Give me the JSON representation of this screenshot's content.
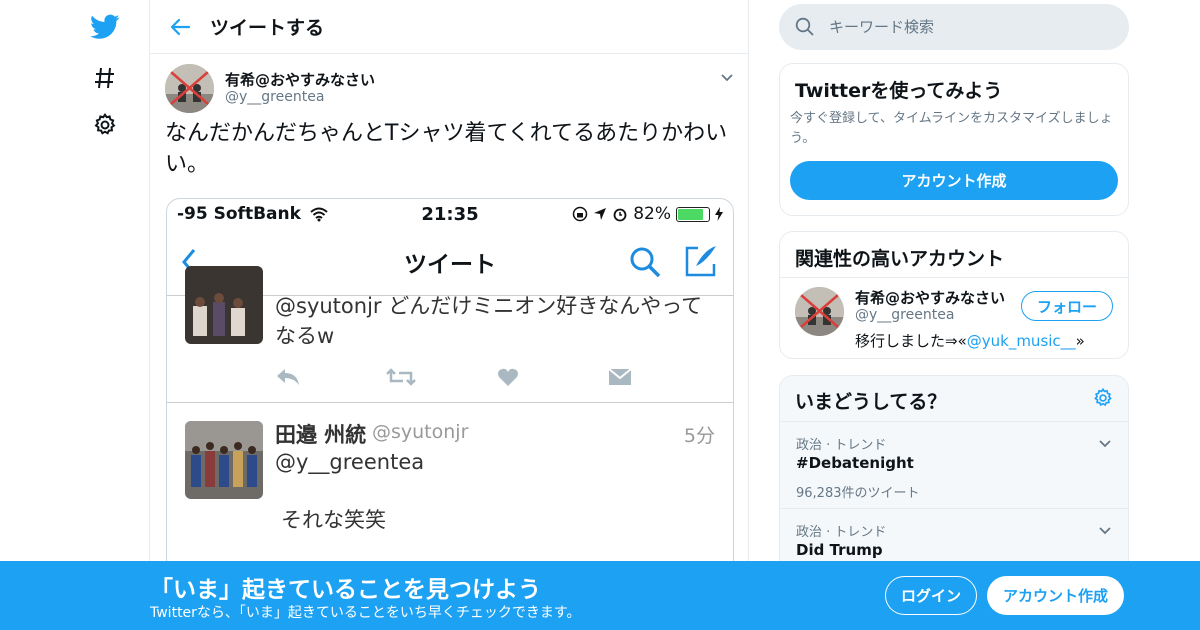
{
  "nav": {
    "icons": [
      "twitter-bird-icon",
      "hashtag-icon",
      "gear-icon"
    ]
  },
  "header": {
    "title": "ツイートする"
  },
  "tweet": {
    "name": "有希@おやすみなさい",
    "handle": "@y__greentea",
    "text": "なんだかんだちゃんとTシャツ着てくれてるあたりかわいい。"
  },
  "screenshot": {
    "carrier": "-95 SoftBank",
    "time": "21:35",
    "battery": "82%",
    "battery_level": 0.82,
    "nav_title": "ツイート",
    "tweet1_text": "@syutonjr どんだけミニオン好きなんやってなるw",
    "tweet2_name": "田邉 州統",
    "tweet2_handle": "@syutonjr",
    "tweet2_time": "5分",
    "tweet2_reply_to": "@y__greentea",
    "tweet2_text": "それな笑笑"
  },
  "search": {
    "placeholder": "キーワード検索"
  },
  "signup_card": {
    "title": "Twitterを使ってみよう",
    "desc": "今すぐ登録して、タイムラインをカスタマイズしましょう。",
    "button": "アカウント作成"
  },
  "related": {
    "title": "関連性の高いアカウント",
    "name": "有希@おやすみなさい",
    "handle": "@y__greentea",
    "bio_prefix": "移行しました⇒«",
    "bio_link": "@yuk_music__",
    "bio_suffix": "»",
    "follow_button": "フォロー"
  },
  "trends": {
    "title": "いまどうしてる？",
    "items": [
      {
        "meta": "政治 · トレンド",
        "name": "#Debatenight",
        "count": "96,283件のツイート"
      },
      {
        "meta": "政治 · トレンド",
        "name": "Did Trump",
        "count": ""
      }
    ]
  },
  "banner": {
    "title": "「いま」起きていることを見つけよう",
    "subtitle": "Twitterなら、「いま」起きていることをいち早くチェックできます。",
    "login": "ログイン",
    "signup": "アカウント作成"
  },
  "colors": {
    "accent": "#1da1f2",
    "border": "#e6ecf0",
    "muted": "#657786"
  }
}
